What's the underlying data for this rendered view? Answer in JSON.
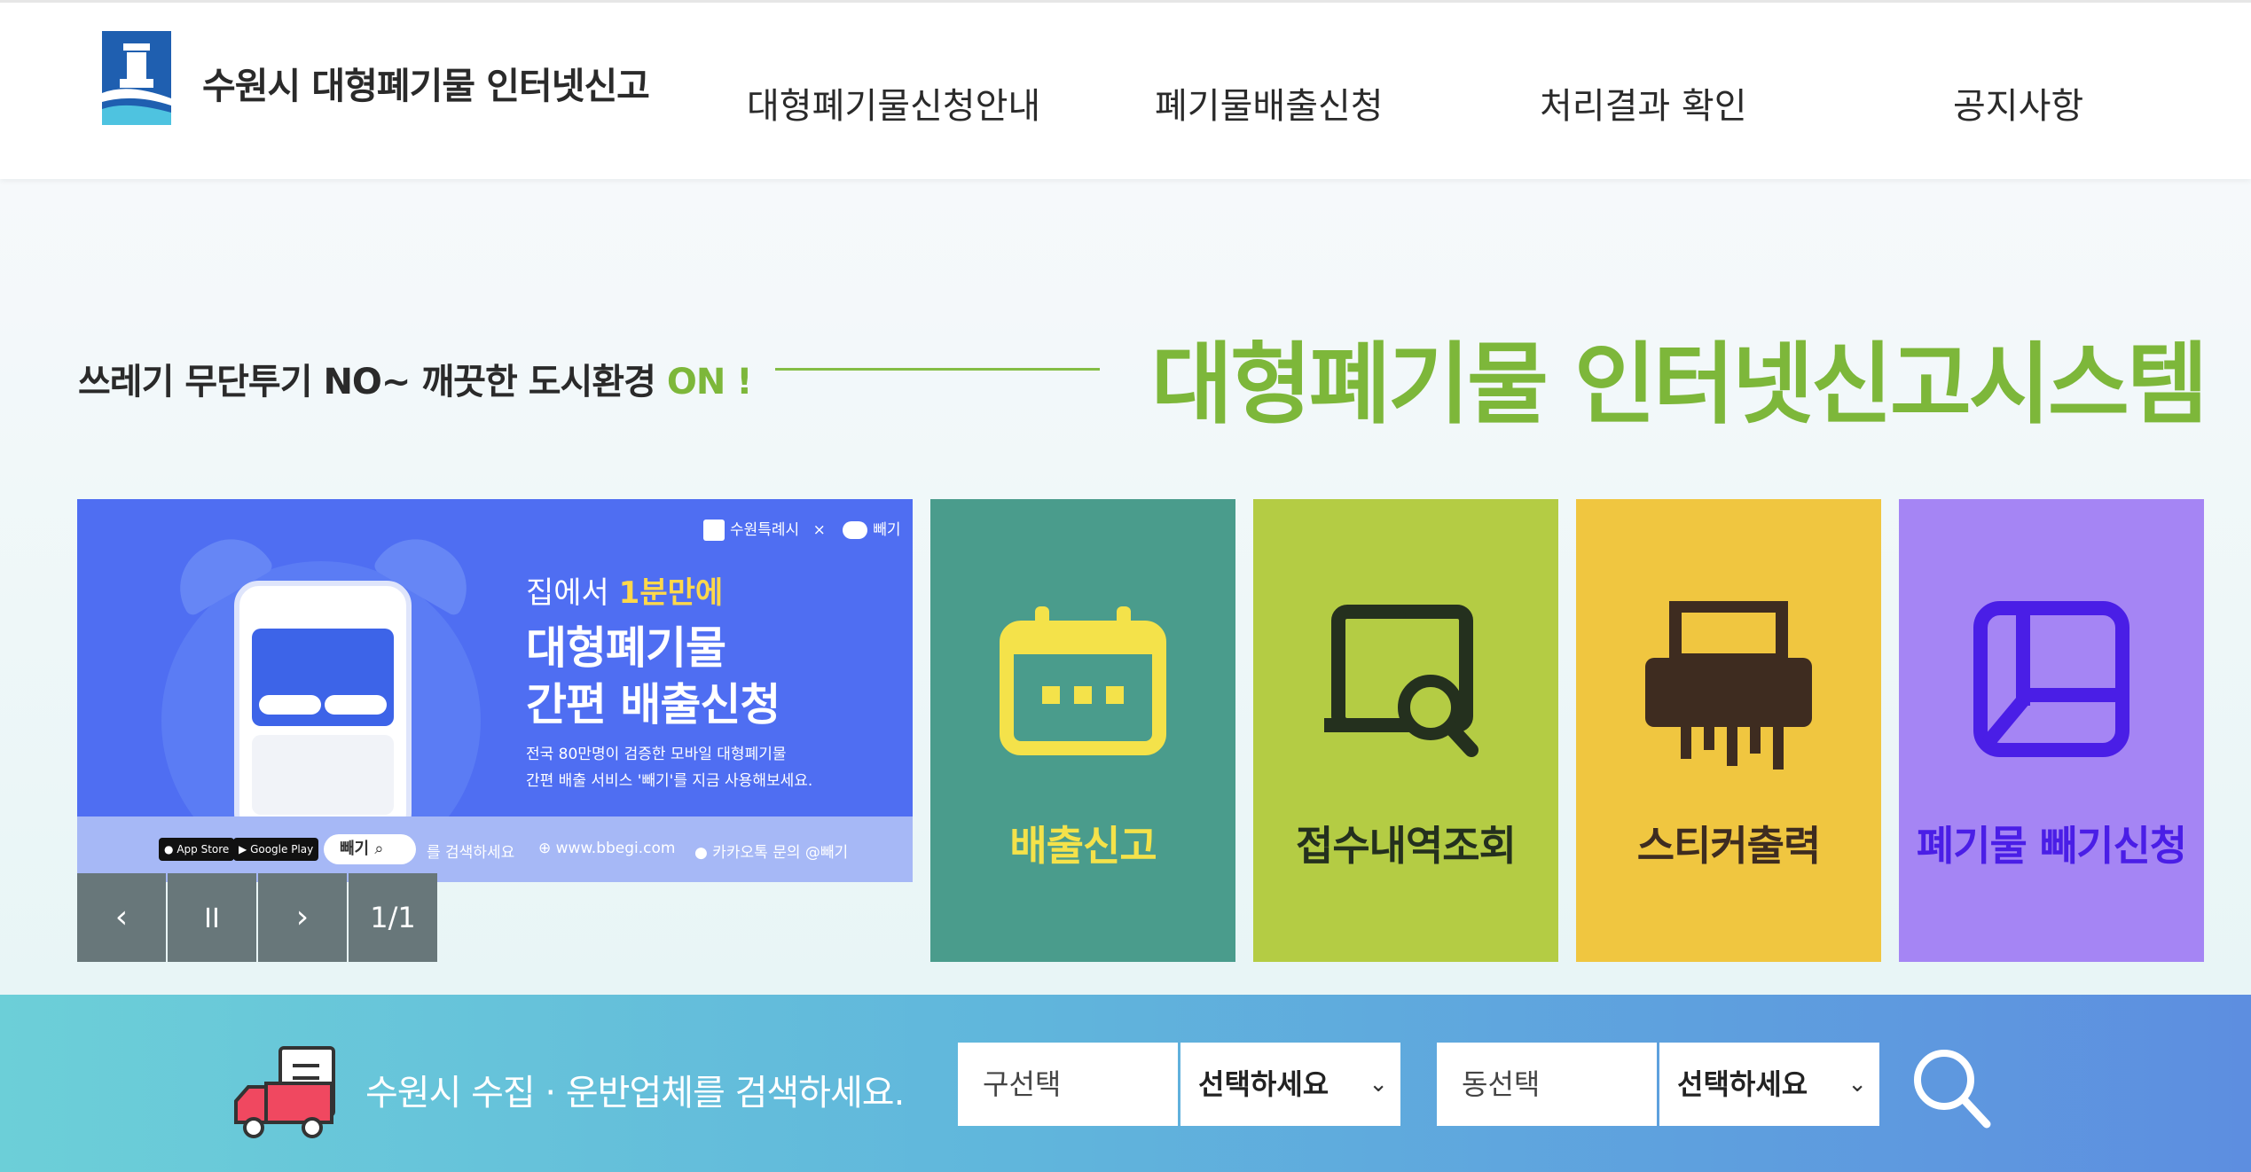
{
  "header": {
    "site_title": "수원시 대형폐기물 인터넷신고",
    "nav": [
      "대형폐기물신청안내",
      "폐기물배출신청",
      "처리결과 확인",
      "공지사항"
    ]
  },
  "hero": {
    "slogan_main": "쓰레기 무단투기 NO~ 깨끗한 도시환경 ",
    "slogan_on": "ON !",
    "title": "대형폐기물 인터넷신고시스템"
  },
  "banner": {
    "brand_city": "수원특례시",
    "brand_x": "×",
    "brand_app": "빼기",
    "line1_pre": "집에서 ",
    "line1_hl": "1분만에",
    "line2": "대형폐기물",
    "line3": "간편 배출신청",
    "desc1": "전국 80만명이 검증한 모바일 대형폐기물",
    "desc2": "간편 배출 서비스 '빼기'를 지금 사용해보세요.",
    "app_store": "App Store",
    "google_play": "Google Play",
    "search_word": "빼기",
    "search_hint": "를 검색하세요",
    "url": "www.bbegi.com",
    "kakao": "카카오톡 문의 @빼기"
  },
  "controls": {
    "prev": "‹",
    "pause": "II",
    "next": "›",
    "counter": "1/1"
  },
  "tiles": [
    {
      "label": "배출신고",
      "bg": "#4a9c8c",
      "fg": "#f4e24a"
    },
    {
      "label": "접수내역조회",
      "bg": "#b4cc44",
      "fg": "#24301e"
    },
    {
      "label": "스티커출력",
      "bg": "#f0c640",
      "fg": "#3e2c20"
    },
    {
      "label": "폐기물 빼기신청",
      "bg": "#a585f4",
      "fg": "#4a1ee6"
    }
  ],
  "search": {
    "label": "수원시 수집 · 운반업체를 검색하세요.",
    "gu_label": "구선택",
    "gu_value": "선택하세요",
    "dong_label": "동선택",
    "dong_value": "선택하세요"
  },
  "colors": {
    "accent_green": "#7db73a",
    "banner_blue": "#4f6ef2"
  }
}
